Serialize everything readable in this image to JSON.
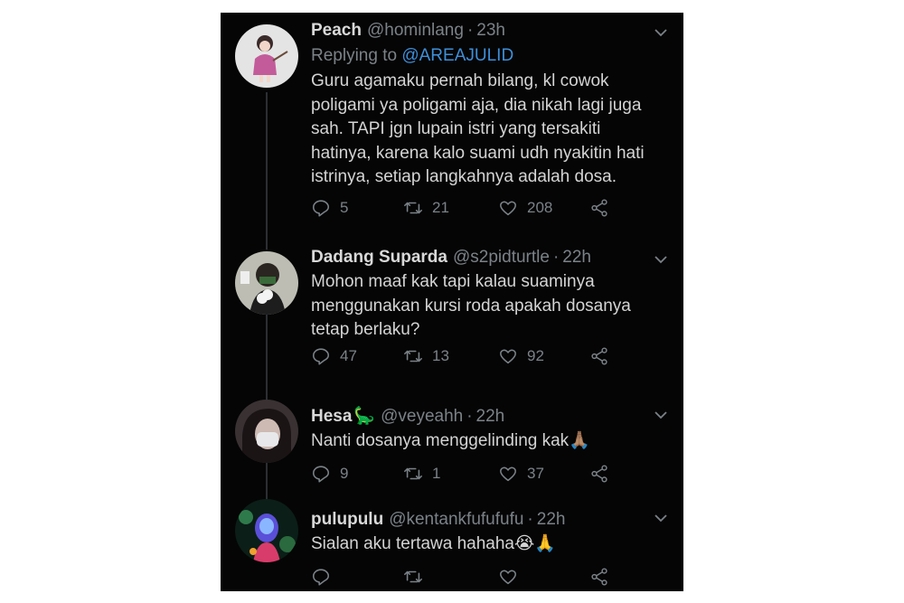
{
  "tweets": [
    {
      "display_name": "Peach",
      "handle": "@hominlang",
      "time": "23h",
      "replying_prefix": "Replying to ",
      "replying_to": "@AREAJULID",
      "text": "Guru agamaku pernah bilang, kl cowok\npoligami ya poligami aja, dia nikah lagi juga\nsah. TAPI jgn lupain istri yang tersakiti\nhatinya, karena kalo suami udh nyakitin hati\nistrinya, setiap langkahnya adalah dosa.",
      "replies": "5",
      "retweets": "21",
      "likes": "208"
    },
    {
      "display_name": "Dadang Suparda",
      "handle": "@s2pidturtle",
      "time": "22h",
      "text": "Mohon maaf kak tapi kalau suaminya\nmenggunakan kursi roda apakah dosanya\ntetap berlaku?",
      "replies": "47",
      "retweets": "13",
      "likes": "92"
    },
    {
      "display_name": "Hesa",
      "name_emoji": "🦕",
      "handle": "@veyeahh",
      "time": "22h",
      "text": "Nanti dosanya menggelinding kak🙏🏽",
      "replies": "9",
      "retweets": "1",
      "likes": "37"
    },
    {
      "display_name": "pulupulu",
      "handle": "@kentankfufufufu",
      "time": "22h",
      "text": "Sialan aku tertawa hahaha😭🙏",
      "replies": "",
      "retweets": "",
      "likes": ""
    }
  ],
  "sep": "·",
  "icons": {
    "reply": "reply-icon",
    "retweet": "retweet-icon",
    "like": "heart-icon",
    "share": "share-icon",
    "more": "chevron-down-icon"
  },
  "colors": {
    "background": "#050505",
    "mention": "#3f8fd9",
    "muted": "#7b8288",
    "text": "#d4d4d4"
  }
}
